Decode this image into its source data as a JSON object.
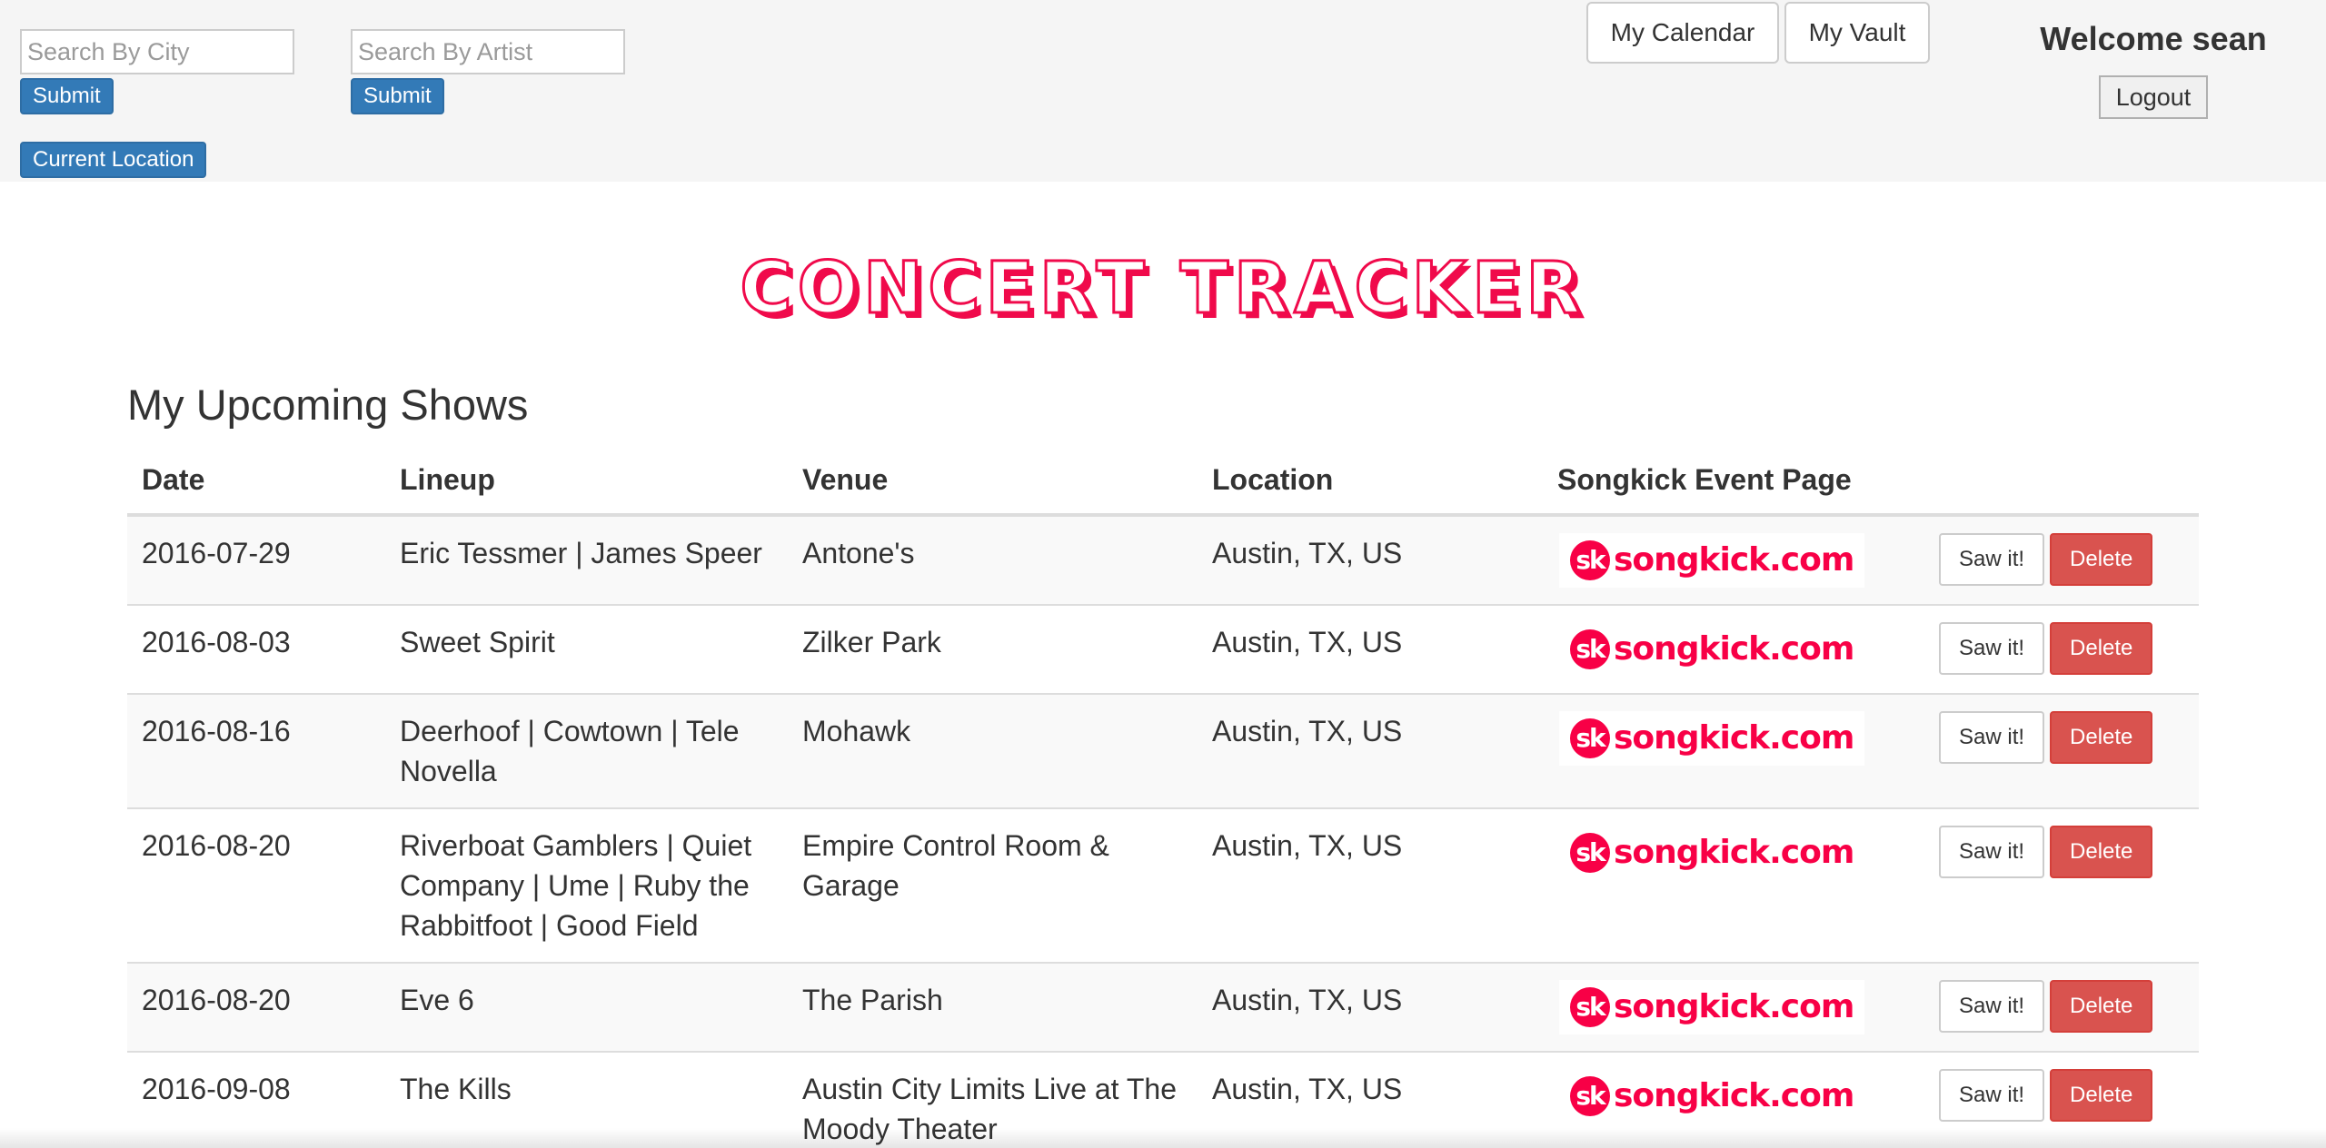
{
  "topbar": {
    "city_search": {
      "placeholder": "Search By City",
      "value": "",
      "submit_label": "Submit"
    },
    "artist_search": {
      "placeholder": "Search By Artist",
      "value": "",
      "submit_label": "Submit"
    },
    "current_location_label": "Current Location",
    "nav": {
      "calendar_label": "My Calendar",
      "vault_label": "My Vault"
    },
    "welcome_text": "Welcome sean",
    "logout_label": "Logout"
  },
  "logo": {
    "text": "CONCERT TRACKER",
    "color": "#f00a4b"
  },
  "section_title": "My Upcoming Shows",
  "table": {
    "headers": [
      "Date",
      "Lineup",
      "Venue",
      "Location",
      "Songkick Event Page"
    ],
    "rows": [
      {
        "date": "2016-07-29",
        "lineup": "Eric Tessmer | James Speer",
        "venue": "Antone's",
        "location": "Austin, TX, US"
      },
      {
        "date": "2016-08-03",
        "lineup": "Sweet Spirit",
        "venue": "Zilker Park",
        "location": "Austin, TX, US"
      },
      {
        "date": "2016-08-16",
        "lineup": "Deerhoof | Cowtown | Tele Novella",
        "venue": "Mohawk",
        "location": "Austin, TX, US"
      },
      {
        "date": "2016-08-20",
        "lineup": "Riverboat Gamblers | Quiet Company | Ume | Ruby the Rabbitfoot | Good Field",
        "venue": "Empire Control Room & Garage",
        "location": "Austin, TX, US"
      },
      {
        "date": "2016-08-20",
        "lineup": "Eve 6",
        "venue": "The Parish",
        "location": "Austin, TX, US"
      },
      {
        "date": "2016-09-08",
        "lineup": "The Kills",
        "venue": "Austin City Limits Live at The Moody Theater",
        "location": "Austin, TX, US"
      }
    ],
    "songkick": {
      "mark": "sk",
      "text": "songkick.com",
      "color": "#f80046"
    },
    "saw_label": "Saw it!",
    "delete_label": "Delete"
  },
  "colors": {
    "primary": "#337ab7",
    "danger": "#d9534f",
    "topbar_bg": "#f5f5f5"
  }
}
